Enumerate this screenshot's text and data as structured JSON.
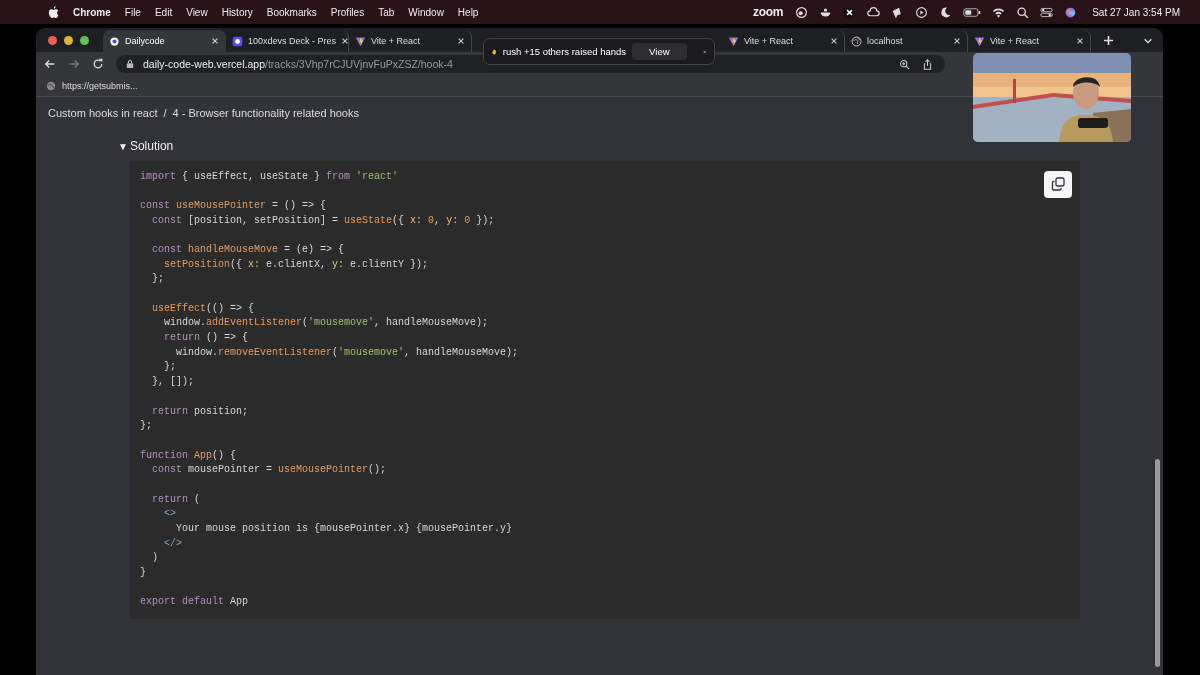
{
  "menu_bar": {
    "app": "Chrome",
    "items": [
      "File",
      "Edit",
      "View",
      "History",
      "Bookmarks",
      "Profiles",
      "Tab",
      "Window",
      "Help"
    ],
    "zoom_label": "zoom",
    "clock": "Sat 27 Jan  3:54 PM"
  },
  "tabs": [
    {
      "label": "Dailycode",
      "kind": "ring",
      "selected": true
    },
    {
      "label": "100xdevs Deck - Pres",
      "kind": "deck",
      "selected": false
    },
    {
      "label": "Vite + React",
      "kind": "vite",
      "selected": false
    },
    {
      "label": "Vite + React",
      "kind": "vite",
      "selected": false
    },
    {
      "label": "localhost",
      "kind": "globe",
      "selected": false
    },
    {
      "label": "Vite + React",
      "kind": "vite",
      "selected": false
    }
  ],
  "address_bar": {
    "host": "daily-code-web.vercel.app",
    "path": "/tracks/3Vhp7rCJUVjnvFuPxZSZ/hook-4"
  },
  "bookmarks": [
    "https://getsubmis..."
  ],
  "notification": {
    "text": "rush +15 others raised hands",
    "button": "View"
  },
  "breadcrumb": [
    "Custom hooks in react",
    "4 - Browser functionality related hooks"
  ],
  "breadcrumb_separator": "/",
  "solution": {
    "icon": "▼",
    "label": "Solution",
    "expanded": true
  },
  "code_blocks": [
    [
      [
        {
          "kind": "kw",
          "t": "import"
        },
        {
          "kind": "p",
          "t": " { useEffect, useState } "
        },
        {
          "kind": "kw",
          "t": "from"
        },
        {
          "kind": "str",
          "t": " 'react'"
        }
      ]
    ],
    [
      [
        {
          "kind": "kw",
          "t": "const"
        },
        {
          "kind": "fn",
          "t": " useMousePointer"
        },
        {
          "kind": "p",
          "t": " = () => {"
        }
      ],
      [
        {
          "kind": "kw",
          "t": "  const"
        },
        {
          "kind": "p",
          "t": " [position, setPosition] = "
        },
        {
          "kind": "fn",
          "t": "useState"
        },
        {
          "kind": "p",
          "t": "({ "
        },
        {
          "kind": "prop",
          "t": "x:"
        },
        {
          "kind": "num",
          "t": " 0"
        },
        {
          "kind": "p",
          "t": ", "
        },
        {
          "kind": "prop",
          "t": "y:"
        },
        {
          "kind": "num",
          "t": " 0"
        },
        {
          "kind": "p",
          "t": " });"
        }
      ]
    ],
    [
      [
        {
          "kind": "kw",
          "t": "  const"
        },
        {
          "kind": "fn",
          "t": " handleMouseMove"
        },
        {
          "kind": "p",
          "t": " = (e) => {"
        }
      ],
      [
        {
          "kind": "fn",
          "t": "    setPosition"
        },
        {
          "kind": "p",
          "t": "({ "
        },
        {
          "kind": "prop",
          "t": "x:"
        },
        {
          "kind": "p",
          "t": " e.clientX, "
        },
        {
          "kind": "prop",
          "t": "y:"
        },
        {
          "kind": "p",
          "t": " e.clientY });"
        }
      ],
      [
        {
          "kind": "p",
          "t": "  };"
        }
      ]
    ],
    [
      [
        {
          "kind": "fn",
          "t": "  useEffect"
        },
        {
          "kind": "p",
          "t": "(() => {"
        }
      ],
      [
        {
          "kind": "p",
          "t": "    window."
        },
        {
          "kind": "fn",
          "t": "addEventListener"
        },
        {
          "kind": "p",
          "t": "("
        },
        {
          "kind": "str",
          "t": "'mousemove'"
        },
        {
          "kind": "p",
          "t": ", handleMouseMove);"
        }
      ],
      [
        {
          "kind": "kw",
          "t": "    return"
        },
        {
          "kind": "p",
          "t": " () => {"
        }
      ],
      [
        {
          "kind": "p",
          "t": "      window."
        },
        {
          "kind": "fn",
          "t": "removeEventListener"
        },
        {
          "kind": "p",
          "t": "("
        },
        {
          "kind": "str",
          "t": "'mousemove'"
        },
        {
          "kind": "p",
          "t": ", handleMouseMove);"
        }
      ],
      [
        {
          "kind": "p",
          "t": "    };"
        }
      ],
      [
        {
          "kind": "p",
          "t": "  }, []);"
        }
      ]
    ],
    [
      [
        {
          "kind": "kw",
          "t": "  return"
        },
        {
          "kind": "p",
          "t": " position;"
        }
      ],
      [
        {
          "kind": "p",
          "t": "};"
        }
      ]
    ],
    [
      [
        {
          "kind": "kw",
          "t": "function"
        },
        {
          "kind": "fn",
          "t": " App"
        },
        {
          "kind": "p",
          "t": "() {"
        }
      ],
      [
        {
          "kind": "kw",
          "t": "  const"
        },
        {
          "kind": "p",
          "t": " mousePointer = "
        },
        {
          "kind": "fn",
          "t": "useMousePointer"
        },
        {
          "kind": "p",
          "t": "();"
        }
      ]
    ],
    [
      [
        {
          "kind": "kw",
          "t": "  return"
        },
        {
          "kind": "p",
          "t": " ("
        }
      ],
      [
        {
          "kind": "tag",
          "t": "    <>"
        }
      ],
      [
        {
          "kind": "p",
          "t": "      Your mouse position is {mousePointer.x} {mousePointer.y}"
        }
      ],
      [
        {
          "kind": "tag",
          "t": "    </>"
        }
      ],
      [
        {
          "kind": "p",
          "t": "  )"
        }
      ],
      [
        {
          "kind": "p",
          "t": "}"
        }
      ]
    ],
    [
      [
        {
          "kind": "kw",
          "t": "export default"
        },
        {
          "kind": "p",
          "t": " App"
        }
      ]
    ]
  ]
}
